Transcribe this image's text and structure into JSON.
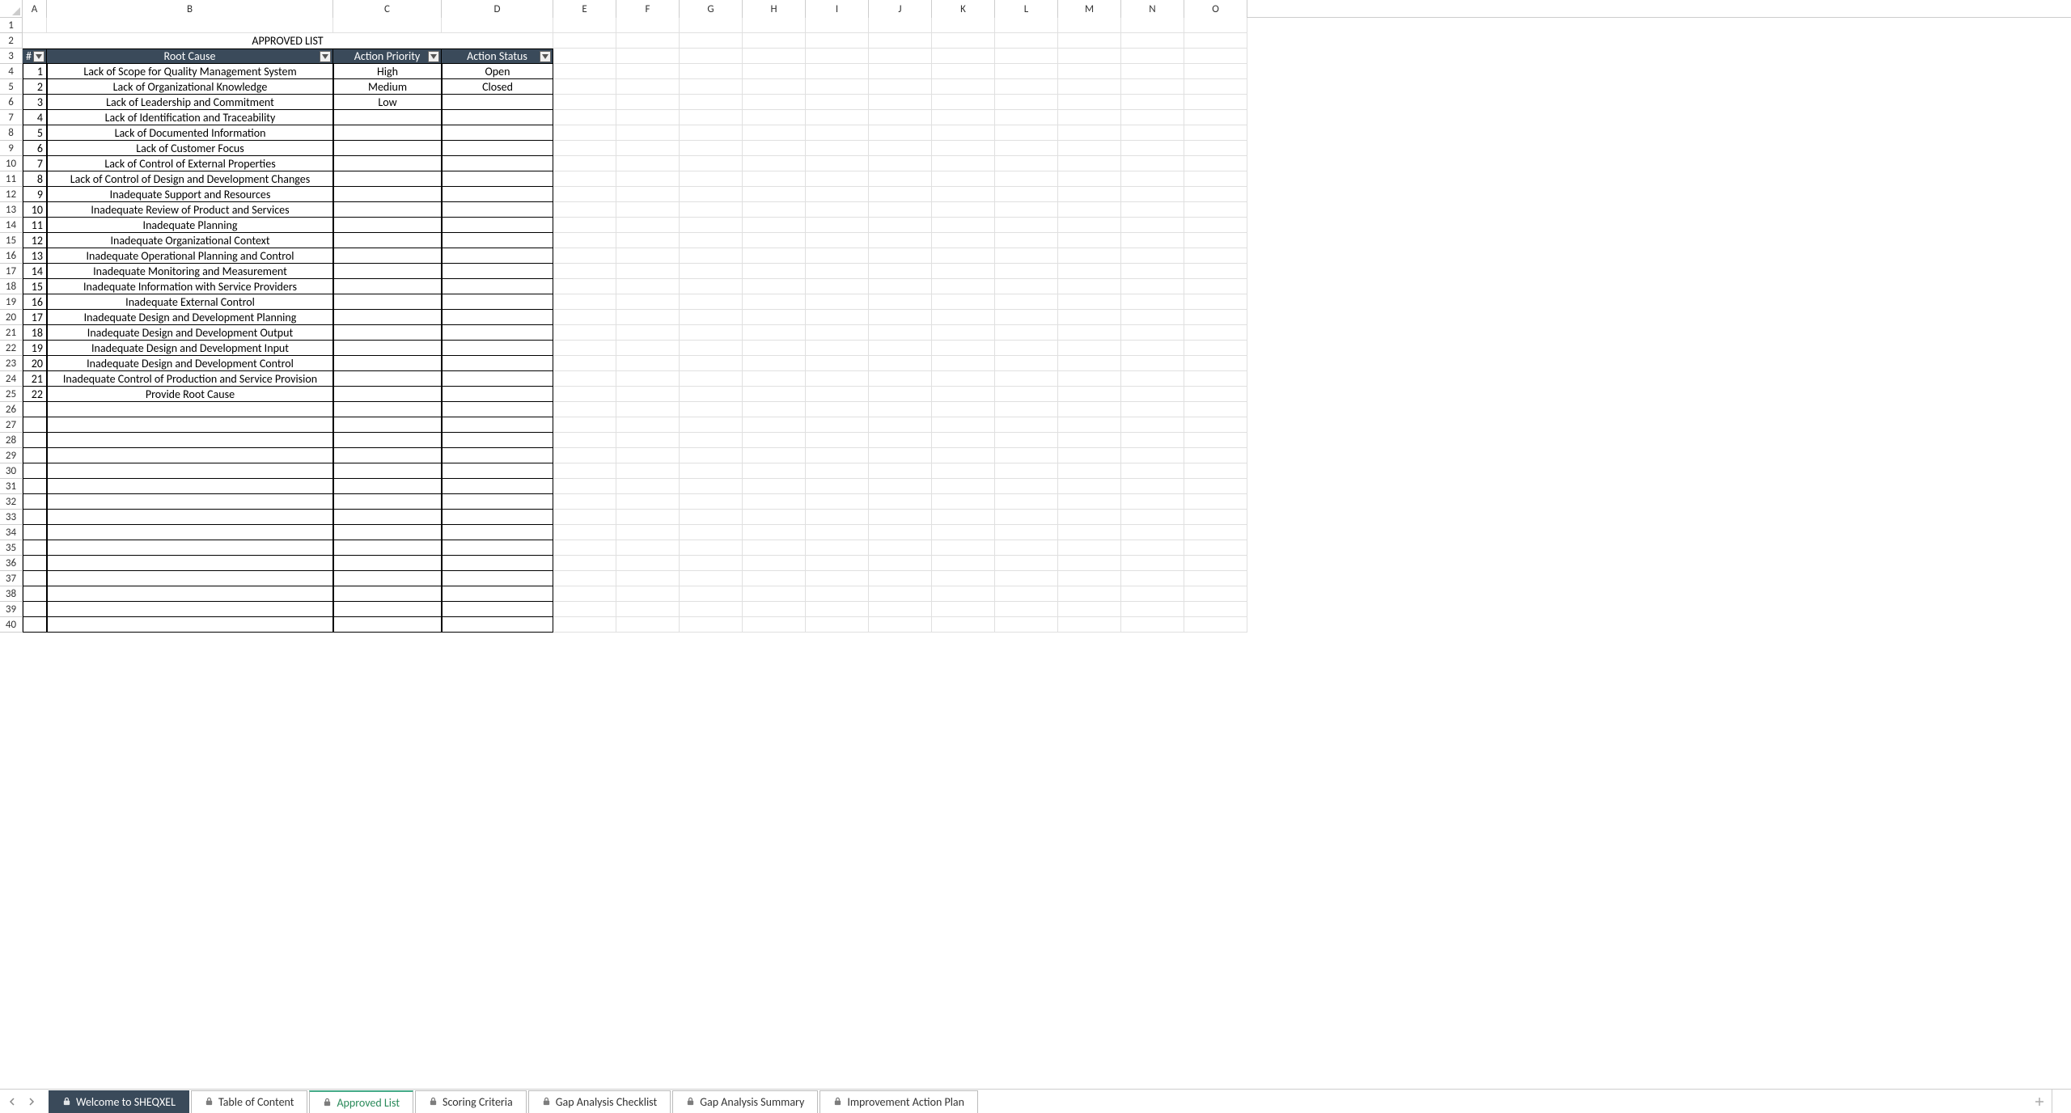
{
  "columns": [
    "A",
    "B",
    "C",
    "D",
    "E",
    "F",
    "G",
    "H",
    "I",
    "J",
    "K",
    "L",
    "M",
    "N",
    "O"
  ],
  "row_count": 40,
  "title_cell": "APPROVED LIST",
  "headers": {
    "num": "#",
    "root_cause": "Root Cause",
    "action_priority": "Action Priority",
    "action_status": "Action Status"
  },
  "rows": [
    {
      "n": "1",
      "rc": "Lack of Scope for Quality Management System",
      "ap": "High",
      "as": "Open"
    },
    {
      "n": "2",
      "rc": "Lack of Organizational Knowledge",
      "ap": "Medium",
      "as": "Closed"
    },
    {
      "n": "3",
      "rc": "Lack of Leadership and Commitment",
      "ap": "Low",
      "as": ""
    },
    {
      "n": "4",
      "rc": "Lack of Identification and Traceability",
      "ap": "",
      "as": ""
    },
    {
      "n": "5",
      "rc": "Lack of Documented Information",
      "ap": "",
      "as": ""
    },
    {
      "n": "6",
      "rc": "Lack of Customer Focus",
      "ap": "",
      "as": ""
    },
    {
      "n": "7",
      "rc": "Lack of Control of External Properties",
      "ap": "",
      "as": ""
    },
    {
      "n": "8",
      "rc": "Lack of Control of Design and Development Changes",
      "ap": "",
      "as": ""
    },
    {
      "n": "9",
      "rc": "Inadequate Support and Resources",
      "ap": "",
      "as": ""
    },
    {
      "n": "10",
      "rc": "Inadequate Review of Product and Services",
      "ap": "",
      "as": ""
    },
    {
      "n": "11",
      "rc": "Inadequate Planning",
      "ap": "",
      "as": ""
    },
    {
      "n": "12",
      "rc": "Inadequate Organizational Context",
      "ap": "",
      "as": ""
    },
    {
      "n": "13",
      "rc": "Inadequate Operational Planning and Control",
      "ap": "",
      "as": ""
    },
    {
      "n": "14",
      "rc": "Inadequate Monitoring and Measurement",
      "ap": "",
      "as": ""
    },
    {
      "n": "15",
      "rc": "Inadequate Information with Service Providers",
      "ap": "",
      "as": ""
    },
    {
      "n": "16",
      "rc": "Inadequate External Control",
      "ap": "",
      "as": ""
    },
    {
      "n": "17",
      "rc": "Inadequate Design and Development Planning",
      "ap": "",
      "as": ""
    },
    {
      "n": "18",
      "rc": "Inadequate Design and Development Output",
      "ap": "",
      "as": ""
    },
    {
      "n": "19",
      "rc": "Inadequate Design and Development Input",
      "ap": "",
      "as": ""
    },
    {
      "n": "20",
      "rc": "Inadequate Design and Development Control",
      "ap": "",
      "as": ""
    },
    {
      "n": "21",
      "rc": "Inadequate Control of Production and Service Provision",
      "ap": "",
      "as": ""
    },
    {
      "n": "22",
      "rc": "Provide Root Cause",
      "ap": "",
      "as": ""
    }
  ],
  "empty_bordered_rows": 15,
  "tabs": [
    {
      "label": "Welcome to SHEQXEL",
      "dark": true,
      "active": false
    },
    {
      "label": "Table of Content",
      "dark": false,
      "active": false
    },
    {
      "label": "Approved List",
      "dark": false,
      "active": true
    },
    {
      "label": "Scoring Criteria",
      "dark": false,
      "active": false
    },
    {
      "label": "Gap Analysis Checklist",
      "dark": false,
      "active": false
    },
    {
      "label": "Gap Analysis Summary",
      "dark": false,
      "active": false
    },
    {
      "label": "Improvement Action Plan",
      "dark": false,
      "active": false
    }
  ]
}
